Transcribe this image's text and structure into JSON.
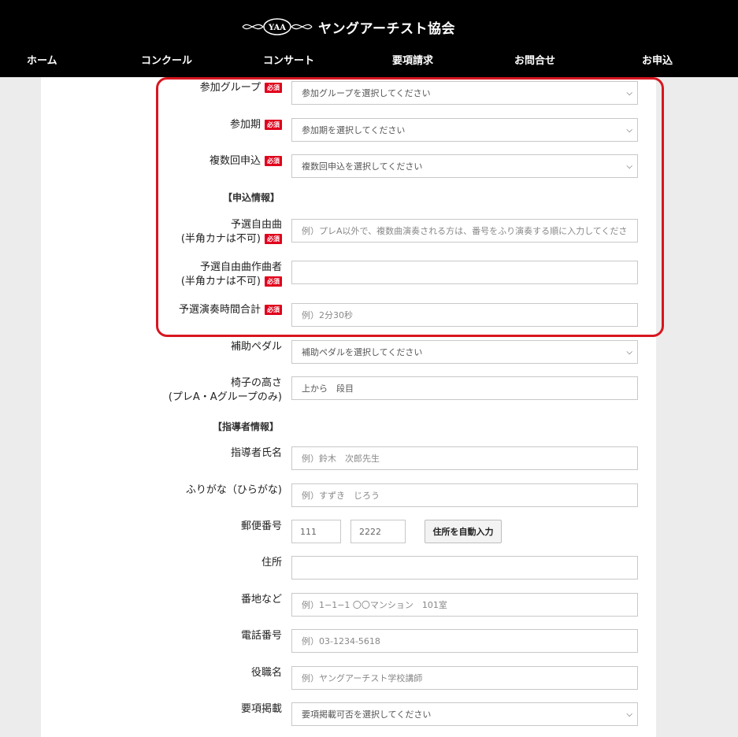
{
  "brand": {
    "emblem_text": "YAA",
    "name": "ヤングアーチスト協会"
  },
  "nav": [
    {
      "label": "ホーム"
    },
    {
      "label": "コンクール"
    },
    {
      "label": "コンサート"
    },
    {
      "label": "要項請求"
    },
    {
      "label": "お問合せ"
    },
    {
      "label": "お申込"
    }
  ],
  "required_badge": "必須",
  "form": {
    "group": {
      "label": "参加グループ",
      "value": "参加グループを選択してください"
    },
    "period": {
      "label": "参加期",
      "value": "参加期を選択してください"
    },
    "multiple": {
      "label": "複数回申込",
      "value": "複数回申込を選択してください"
    },
    "section_application": "【申込情報】",
    "piece": {
      "label_line1": "予選自由曲",
      "label_line2": "(半角カナは不可)",
      "placeholder": "例）プレA以外で、複数曲演奏される方は、番号をふり演奏する順に入力してくださ"
    },
    "composer": {
      "label_line1": "予選自由曲作曲者",
      "label_line2": "(半角カナは不可)",
      "value": ""
    },
    "duration": {
      "label": "予選演奏時間合計",
      "placeholder": "例）2分30秒"
    },
    "pedal": {
      "label": "補助ペダル",
      "value": "補助ペダルを選択してください"
    },
    "chair": {
      "label_line1": "椅子の高さ",
      "label_line2": "(プレA・Aグループのみ)",
      "value": "上から　段目"
    },
    "section_teacher": "【指導者情報】",
    "teacher_name": {
      "label": "指導者氏名",
      "placeholder": "例）鈴木　次郎先生"
    },
    "teacher_kana": {
      "label": "ふりがな（ひらがな)",
      "placeholder": "例）すずき　じろう"
    },
    "postal": {
      "label": "郵便番号",
      "part1": "111",
      "part2": "2222",
      "button": "住所を自動入力"
    },
    "address": {
      "label": "住所",
      "value": ""
    },
    "street": {
      "label": "番地など",
      "placeholder": "例）1−1−1 〇〇マンション　101室"
    },
    "phone": {
      "label": "電話番号",
      "placeholder": "例）03-1234-5618"
    },
    "title": {
      "label": "役職名",
      "placeholder": "例）ヤングアーチスト学校講師"
    },
    "listing": {
      "label": "要項掲載",
      "value": "要項掲載可否を選択してください"
    }
  },
  "colors": {
    "header_bg": "#000000",
    "badge": "#e0001b",
    "highlight": "#d8161f"
  }
}
